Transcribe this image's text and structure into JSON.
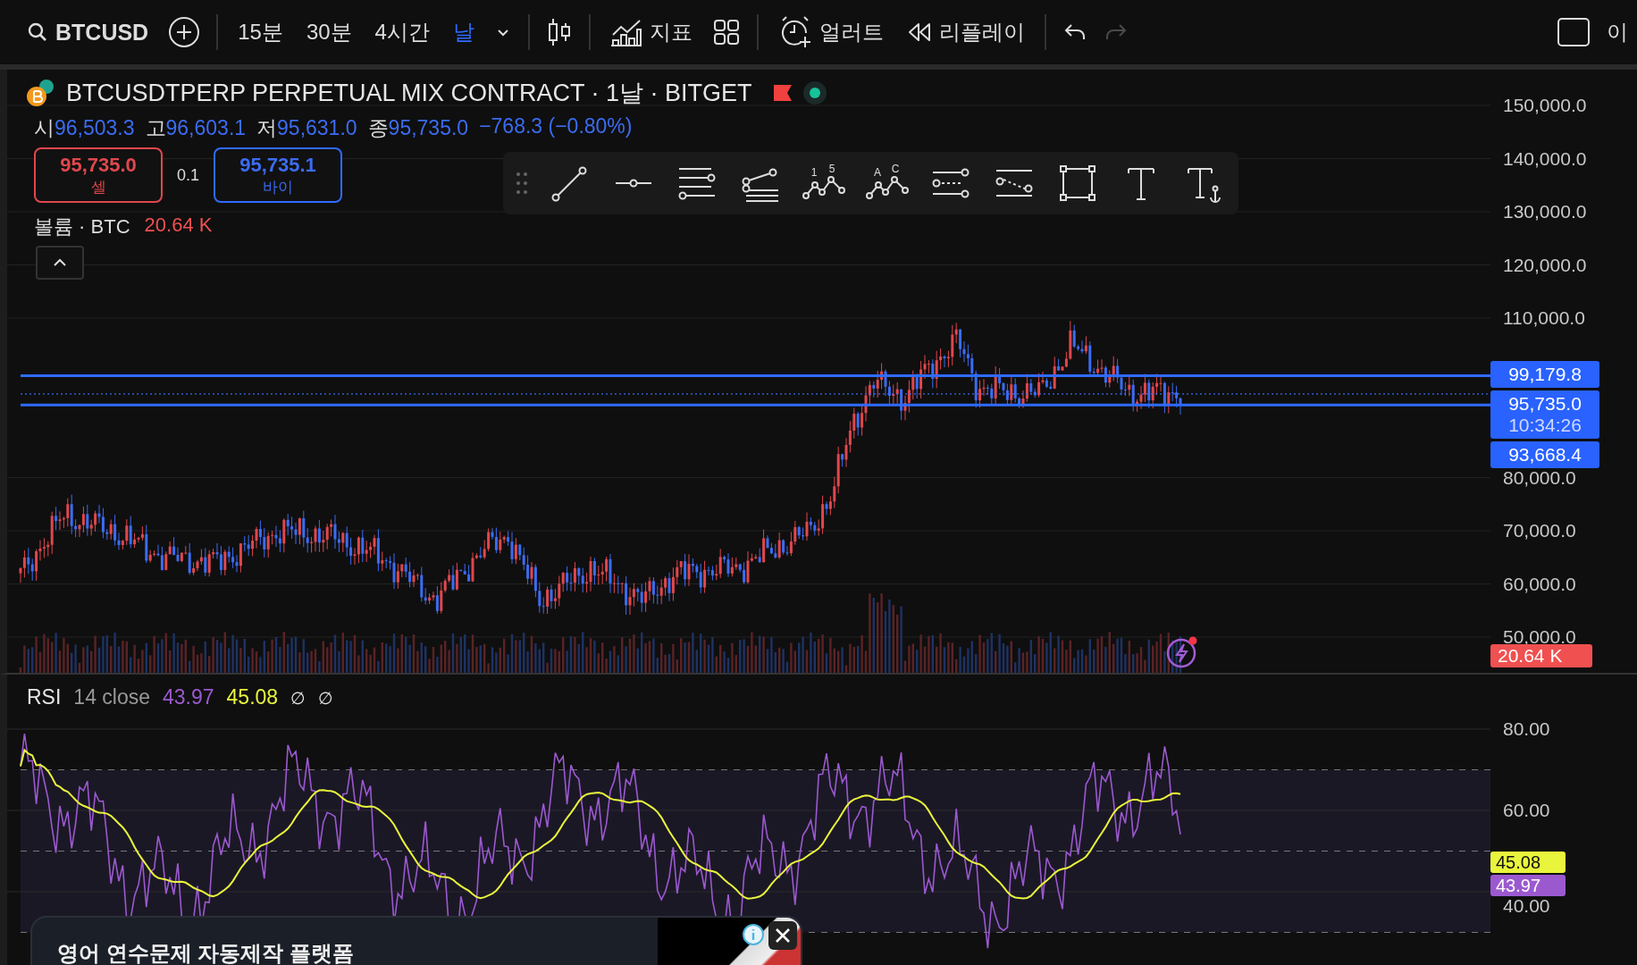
{
  "toolbar": {
    "symbol": "BTCUSD",
    "intervals": [
      {
        "label": "15분",
        "selected": false
      },
      {
        "label": "30분",
        "selected": false
      },
      {
        "label": "4시간",
        "selected": false
      },
      {
        "label": "날",
        "selected": true
      }
    ],
    "indicators_label": "지표",
    "alert_label": "얼러트",
    "replay_label": "리플레이",
    "redo": {
      "disabled": true
    },
    "cut_label": "이"
  },
  "legend": {
    "title": "BTCUSDTPERP PERPETUAL MIX CONTRACT · 1날 · BITGET",
    "ohlc": [
      {
        "label": "시",
        "value": "96,503.3"
      },
      {
        "label": "고",
        "value": "96,603.1"
      },
      {
        "label": "저",
        "value": "95,631.0"
      },
      {
        "label": "종",
        "value": "95,735.0"
      }
    ],
    "change": "−768.3 (−0.80%)",
    "sell": {
      "price": "95,735.0",
      "label": "셀"
    },
    "spread": "0.1",
    "buy": {
      "price": "95,735.1",
      "label": "바이"
    },
    "volume": {
      "label": "볼륨 · BTC",
      "value": "20.64 K"
    }
  },
  "drawing_tools": [
    {
      "kind": "trend"
    },
    {
      "kind": "ray"
    },
    {
      "kind": "channel"
    },
    {
      "kind": "fib"
    },
    {
      "kind": "wave",
      "labels": [
        "1",
        "5"
      ]
    },
    {
      "kind": "wave",
      "labels": [
        "A",
        "C"
      ]
    },
    {
      "kind": "range"
    },
    {
      "kind": "projection"
    },
    {
      "kind": "rect"
    },
    {
      "kind": "text"
    },
    {
      "kind": "anchored-text"
    }
  ],
  "price_axis": {
    "ticks": [
      "150,000.0",
      "140,000.0",
      "130,000.0",
      "120,000.0",
      "110,000.0",
      "80,000.0",
      "70,000.0",
      "60,000.0",
      "50,000.0"
    ],
    "labels": [
      {
        "text": "99,179.8"
      },
      {
        "text": "95,735.0",
        "sub": "10:34:26"
      },
      {
        "text": "93,668.4"
      }
    ],
    "volume_badge": "20.64 K"
  },
  "rsi": {
    "label": "RSI",
    "params": "14 close",
    "value": "43.97",
    "ma_value": "45.08",
    "extras": [
      "∅",
      "∅"
    ],
    "ticks": [
      "80.00",
      "60.00",
      "40.00"
    ],
    "badges": [
      {
        "text": "45.08",
        "color": "#e9f53c"
      },
      {
        "text": "43.97",
        "color": "#9b59cf"
      }
    ]
  },
  "ad": {
    "text": "영어 연수문제 자동제작 플랫폼"
  }
}
